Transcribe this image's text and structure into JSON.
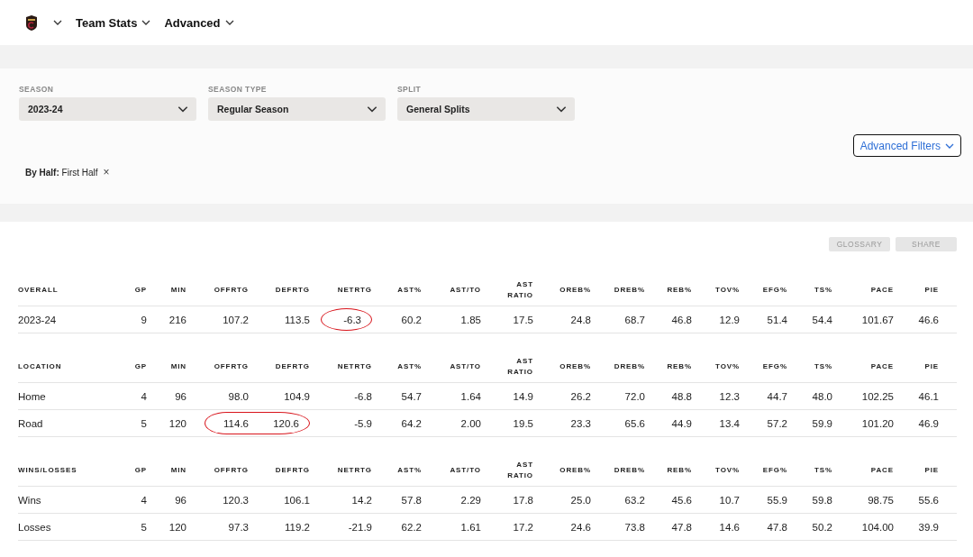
{
  "nav": {
    "menus": [
      {
        "label": "Team Stats"
      },
      {
        "label": "Advanced"
      }
    ]
  },
  "filters": [
    {
      "label": "SEASON",
      "value": "2023-24"
    },
    {
      "label": "SEASON TYPE",
      "value": "Regular Season"
    },
    {
      "label": "SPLIT",
      "value": "General Splits"
    }
  ],
  "advanced_filters_button": "Advanced Filters",
  "active_filter": {
    "name": "By Half:",
    "value": "First Half",
    "remove": "×"
  },
  "actions": [
    "GLOSSARY",
    "SHARE"
  ],
  "sections": [
    {
      "title": "OVERALL",
      "columns": [
        "GP",
        "MIN",
        "OFFRTG",
        "DEFRTG",
        "NETRTG",
        "AST%",
        "AST/TO",
        "AST RATIO",
        "OREB%",
        "DREB%",
        "REB%",
        "TOV%",
        "EFG%",
        "TS%",
        "PACE",
        "PIE"
      ],
      "rows": [
        {
          "label": "2023-24",
          "values": [
            "9",
            "216",
            "107.2",
            "113.5",
            "-6.3",
            "60.2",
            "1.85",
            "17.5",
            "24.8",
            "68.7",
            "46.8",
            "12.9",
            "51.4",
            "54.4",
            "101.67",
            "46.6"
          ],
          "circled": [
            false,
            false,
            false,
            false,
            true,
            false,
            false,
            false,
            false,
            false,
            false,
            false,
            false,
            false,
            false,
            false
          ]
        }
      ]
    },
    {
      "title": "LOCATION",
      "columns": [
        "GP",
        "MIN",
        "OFFRTG",
        "DEFRTG",
        "NETRTG",
        "AST%",
        "AST/TO",
        "AST RATIO",
        "OREB%",
        "DREB%",
        "REB%",
        "TOV%",
        "EFG%",
        "TS%",
        "PACE",
        "PIE"
      ],
      "rows": [
        {
          "label": "Home",
          "values": [
            "4",
            "96",
            "98.0",
            "104.9",
            "-6.8",
            "54.7",
            "1.64",
            "14.9",
            "26.2",
            "72.0",
            "48.8",
            "12.3",
            "44.7",
            "48.0",
            "102.25",
            "46.1"
          ],
          "circled": [
            false,
            false,
            false,
            false,
            false,
            false,
            false,
            false,
            false,
            false,
            false,
            false,
            false,
            false,
            false,
            false
          ]
        },
        {
          "label": "Road",
          "values": [
            "5",
            "120",
            "114.6",
            "120.6",
            "-5.9",
            "64.2",
            "2.00",
            "19.5",
            "23.3",
            "65.6",
            "44.9",
            "13.4",
            "57.2",
            "59.9",
            "101.20",
            "46.9"
          ],
          "circled": [
            false,
            false,
            true,
            true,
            false,
            false,
            false,
            false,
            false,
            false,
            false,
            false,
            false,
            false,
            false,
            false
          ]
        }
      ]
    },
    {
      "title": "WINS/LOSSES",
      "columns": [
        "GP",
        "MIN",
        "OFFRTG",
        "DEFRTG",
        "NETRTG",
        "AST%",
        "AST/TO",
        "AST RATIO",
        "OREB%",
        "DREB%",
        "REB%",
        "TOV%",
        "EFG%",
        "TS%",
        "PACE",
        "PIE"
      ],
      "rows": [
        {
          "label": "Wins",
          "values": [
            "4",
            "96",
            "120.3",
            "106.1",
            "14.2",
            "57.8",
            "2.29",
            "17.8",
            "25.0",
            "63.2",
            "45.6",
            "10.7",
            "55.9",
            "59.8",
            "98.75",
            "55.6"
          ],
          "circled": [
            false,
            false,
            false,
            false,
            false,
            false,
            false,
            false,
            false,
            false,
            false,
            false,
            false,
            false,
            false,
            false
          ]
        },
        {
          "label": "Losses",
          "values": [
            "5",
            "120",
            "97.3",
            "119.2",
            "-21.9",
            "62.2",
            "1.61",
            "17.2",
            "24.6",
            "73.8",
            "47.8",
            "14.6",
            "47.8",
            "50.2",
            "104.00",
            "39.9"
          ],
          "circled": [
            false,
            false,
            false,
            false,
            false,
            false,
            false,
            false,
            false,
            false,
            false,
            false,
            false,
            false,
            false,
            false
          ]
        }
      ]
    }
  ]
}
